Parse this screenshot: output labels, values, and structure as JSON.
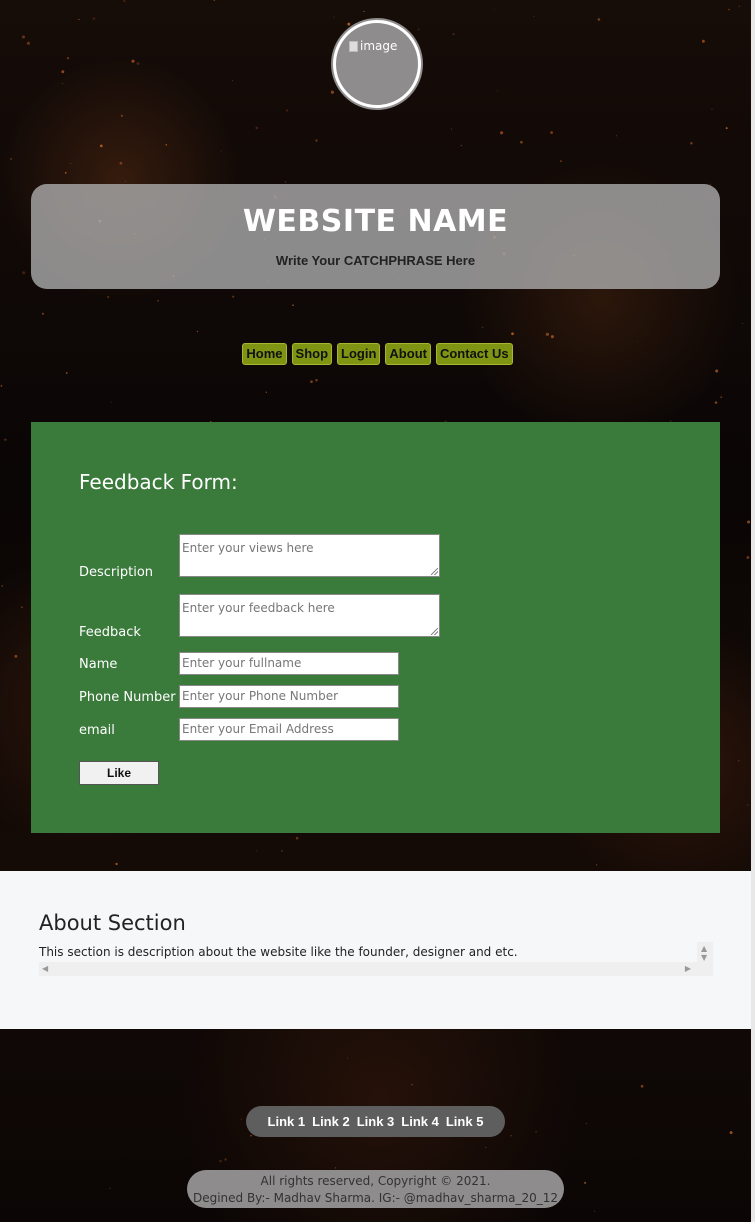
{
  "logo": {
    "alt": "image"
  },
  "header": {
    "title": "WEBSITE NAME",
    "tagline_prefix": "Write Your",
    "tagline_strong": "CATCHPHRASE",
    "tagline_suffix": "Here"
  },
  "nav": {
    "items": [
      "Home",
      "Shop",
      "Login",
      "About",
      "Contact Us"
    ]
  },
  "form": {
    "title": "Feedback Form:",
    "description_label": "Description",
    "description_placeholder": "Enter your views here",
    "feedback_label": "Feedback",
    "feedback_placeholder": "Enter your feedback here",
    "name_label": "Name",
    "name_placeholder": "Enter your fullname",
    "phone_label": "Phone Number",
    "phone_placeholder": "Enter your Phone Number",
    "email_label": "email",
    "email_placeholder": "Enter your Email Address",
    "submit_label": "Like"
  },
  "about": {
    "title": "About Section",
    "text": "This section is description about the website like the founder, designer and etc."
  },
  "footer": {
    "links": [
      "Link 1",
      "Link 2",
      "Link 3",
      "Link 4",
      "Link 5"
    ],
    "copyright": "All rights reserved, Copyright © 2021.",
    "credit": "Degined By:- Madhav Sharma. IG:- @madhav_sharma_20_12"
  },
  "colors": {
    "form_bg": "#3a7a3b",
    "nav_bg": "#7f9412",
    "hero_bg": "#a8a8a8",
    "about_bg": "#f6f7f9"
  }
}
